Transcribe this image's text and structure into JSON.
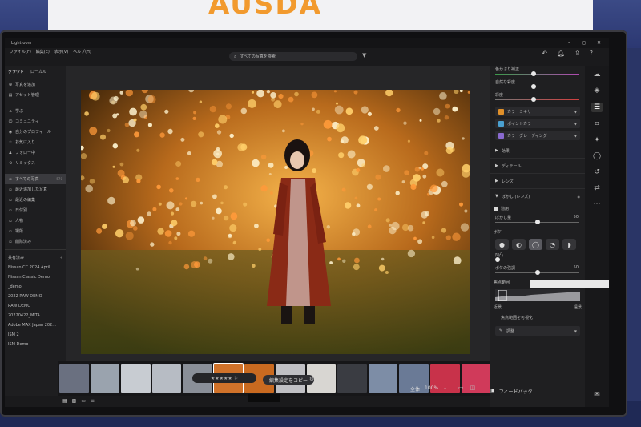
{
  "banner": {
    "text": "AUSDA"
  },
  "app": {
    "name": "Lightroom",
    "window_controls": [
      "–",
      "◻",
      "✕"
    ],
    "menu": [
      "ファイル(F)",
      "編集(E)",
      "表示(V)",
      "ヘルプ(H)"
    ],
    "search_placeholder": "すべての写真を検索"
  },
  "left_panel": {
    "tabs": [
      {
        "label": "クラウド",
        "active": true
      },
      {
        "label": "ローカル",
        "active": false
      }
    ],
    "add_photos": "写真を追加",
    "asset_manage": "アセット管理",
    "community": [
      {
        "icon": "home-icon",
        "label": "学ぶ"
      },
      {
        "icon": "community-icon",
        "label": "コミュニティ"
      },
      {
        "icon": "profile-icon",
        "label": "自分のプロフィール"
      },
      {
        "icon": "star-icon",
        "label": "お気に入り"
      },
      {
        "icon": "follow-icon",
        "label": "フォロー中"
      },
      {
        "icon": "remix-icon",
        "label": "リミックス"
      }
    ],
    "library": [
      {
        "label": "すべての写真",
        "count": "570",
        "selected": true
      },
      {
        "label": "最近追加した写真",
        "count": ""
      },
      {
        "label": "最近の編集",
        "count": ""
      },
      {
        "label": "日付別",
        "count": ""
      },
      {
        "label": "人物",
        "count": ""
      },
      {
        "label": "場所",
        "count": ""
      },
      {
        "label": "削除済み",
        "count": ""
      }
    ],
    "albums_header": "共有済み",
    "albums": [
      {
        "label": "Nissan CC 2024 April"
      },
      {
        "label": "Nissan Classic Demo"
      },
      {
        "label": "_demo"
      },
      {
        "label": "2022 RAW DEMO"
      },
      {
        "label": "RAW DEMO"
      },
      {
        "label": "20220422_MITA"
      },
      {
        "label": "Adobe MAX Japan 202..."
      },
      {
        "label": "ISM 2"
      },
      {
        "label": "ISM Demo"
      }
    ]
  },
  "filmstrip": {
    "thumbs": [
      "#6a7080",
      "#9aa3ae",
      "#c8ccd2",
      "#b7bcc4",
      "#8a8f98",
      "#d0722a",
      "#c96a20",
      "#c0c0c4",
      "#d8d6d2",
      "#3a3c42",
      "#7d8da6",
      "#6a7a96",
      "#c8324a",
      "#d03a5a"
    ]
  },
  "bottom": {
    "rating_stars": "★★★★★",
    "copy_settings": "編集設定をコピー",
    "zoom_label": "全体",
    "zoom_value": "100%"
  },
  "right_panel": {
    "sliders": [
      {
        "label": "色かぶり補正",
        "pos": 0.45,
        "gradient": "linear-gradient(90deg,#3b9a4a,#b04ab0)"
      },
      {
        "label": "自然な彩度",
        "pos": 0.45,
        "gradient": "linear-gradient(90deg,#777,#d04040)"
      },
      {
        "label": "彩度",
        "pos": 0.45,
        "gradient": "linear-gradient(90deg,#777,#d04040)"
      }
    ],
    "dropdowns": [
      {
        "label": "カラーミキサー",
        "color": "#e0902a"
      },
      {
        "label": "ポイントカラー",
        "color": "#4aa0d0"
      },
      {
        "label": "カラーグレーディング",
        "color": "#8a6ad0"
      }
    ],
    "sections": [
      "効果",
      "ディテール",
      "レンズ"
    ],
    "blur": {
      "title": "ぼかし (レンズ)",
      "apply": "適用",
      "amount_label": "ぼかし量",
      "amount_value": "50",
      "amount_pos": 0.5,
      "shape_label": "ボケ",
      "focus_label": "焦点範囲",
      "near_label": "近景",
      "far_label": "遠景",
      "visualize": "焦点範囲を可視化",
      "bokeh_label": "ボケの強調",
      "bokeh_value": "50",
      "bokeh_pos": 0.5,
      "mirror_label": "凹凸",
      "mirror_pos": 0.0,
      "brush_label": "調整"
    },
    "shapes": [
      "●",
      "◐",
      "◯",
      "◔",
      "◗"
    ],
    "feedback": "フィードバック"
  }
}
